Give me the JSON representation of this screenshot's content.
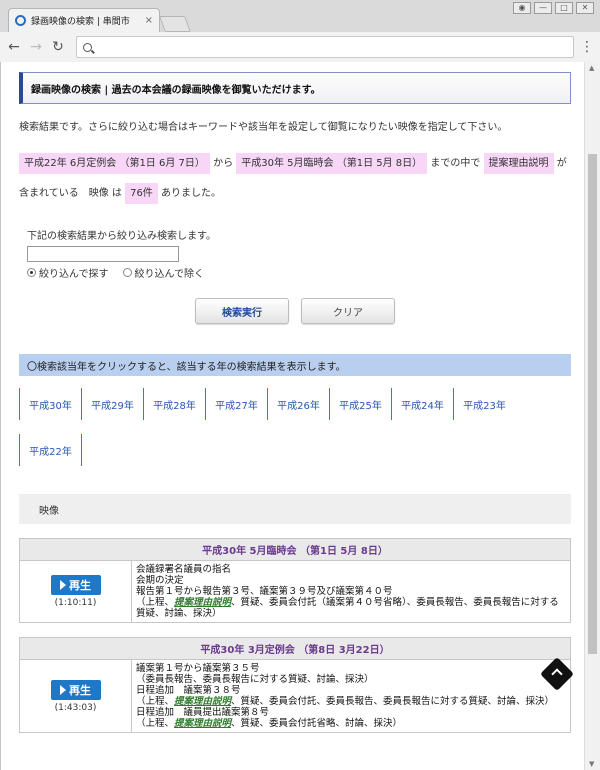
{
  "browser": {
    "tab_title": "録画映像の検索 | 串間市",
    "tab_close": "×",
    "window_controls": [
      "user-icon",
      "minimize-icon",
      "maximize-icon",
      "close-icon"
    ]
  },
  "page": {
    "header": "録画映像の検索 | 過去の本会議の録画映像を御覧いただけます。",
    "lead": "検索結果です。さらに絞り込む場合はキーワードや該当年を設定して御覧になりたい映像を指定して下さい。",
    "result": {
      "from_label": "平成22年 6月定例会 （第1日 6月 7日）",
      "from_text": "から",
      "to_label": "平成30年 5月臨時会 （第1日 5月 8日）",
      "to_text": "までの中で",
      "keyword": "提案理由説明",
      "contains_text": "が含まれている　映像 は",
      "count": "76件",
      "end_text": "ありました。"
    },
    "filter": {
      "label": "下記の検索結果から絞り込み検索します。",
      "value": "",
      "radio_include": "絞り込んで探す",
      "radio_exclude": "絞り込んで除く",
      "selected": "include"
    },
    "buttons": {
      "search": "検索実行",
      "clear": "クリア"
    },
    "year_bar": "〇検索該当年をクリックすると、該当する年の検索結果を表示します。",
    "years": [
      "平成30年",
      "平成29年",
      "平成28年",
      "平成27年",
      "平成26年",
      "平成25年",
      "平成24年",
      "平成23年",
      "平成22年"
    ],
    "video_bar": "映像",
    "records": [
      {
        "title": "平成30年 5月臨時会 （第1日 5月 8日）",
        "play": "再生",
        "duration": "(1:10:11)",
        "lines": [
          {
            "text": "会議録署名議員の指名"
          },
          {
            "text": "会期の決定"
          },
          {
            "text": "報告第１号から報告第３号、議案第３９号及び議案第４０号"
          },
          {
            "pre": "（上程、",
            "link": "提案理由説明",
            "post": "、質疑、委員会付託（議案第４０号省略）、委員長報告、委員長報告に対する質疑、討論、採決）"
          }
        ]
      },
      {
        "title": "平成30年 3月定例会 （第8日 3月22日）",
        "play": "再生",
        "duration": "(1:43:03)",
        "lines": [
          {
            "text": "議案第１号から議案第３５号"
          },
          {
            "text": "（委員長報告、委員長報告に対する質疑、討論、採決）"
          },
          {
            "text": "日程追加　議案第３８号"
          },
          {
            "pre": "（上程、",
            "link": "提案理由説明",
            "post": "、質疑、委員会付託、委員長報告、委員長報告に対する質疑、討論、採決）"
          },
          {
            "text": "日程追加　議員提出議案第８号"
          },
          {
            "pre": "（上程、",
            "link": "提案理由説明",
            "post": "、質疑、委員会付託省略、討論、採決）"
          }
        ]
      }
    ]
  },
  "colors": {
    "highlight": "#f7d6f7",
    "year_bar": "#b9cff0",
    "play": "#1f77c8",
    "record_title": "#6a3a8c",
    "link": "#2f7b2b"
  }
}
